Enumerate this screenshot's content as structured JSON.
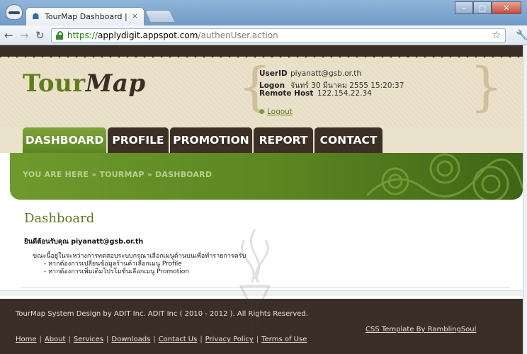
{
  "browser": {
    "tab_title": "TourMap Dashboard | [ Pov",
    "tab_close": "×",
    "url_scheme": "https://",
    "url_host": "applydigit.appspot.com",
    "url_path": "/authenUser.action",
    "window_min": "–",
    "window_max": "□",
    "window_close": "✕"
  },
  "header": {
    "logo_tour": "Tour",
    "logo_map": "Map",
    "user": {
      "userid_label": "UserID",
      "userid_value": "piyanatt@gsb.or.th",
      "logon_label": "Logon",
      "logon_value": "จันทร์ 30 มีนาคม 2555 15:20:37",
      "remote_label": "Remote Host",
      "remote_value": "122.154.22.34",
      "logout": "Logout"
    }
  },
  "nav": {
    "tabs": [
      {
        "label": "DASHBOARD",
        "active": true
      },
      {
        "label": "PROFILE",
        "active": false
      },
      {
        "label": "PROMOTION",
        "active": false
      },
      {
        "label": "REPORT",
        "active": false
      },
      {
        "label": "CONTACT",
        "active": false
      }
    ]
  },
  "breadcrumb": "YOU ARE HERE » TOURMAP » DASHBOARD",
  "content": {
    "title": "Dashboard",
    "welcome": "ยินดีต้อนรับคุณ piyanatt@gsb.or.th",
    "lines": [
      "ขณะนี้อยู่ในระหว่างการทดสอบระบบกรุณาเลือกเมนูด้านบนเพื่อทำรายการครับ",
      "- หากต้องการเปลี่ยนข้อมูลร้านค้าเลือกเมนู Profile",
      "- หากต้องการเพิ่มเติมโปรโมชั่นเลือกเมนู Promotion"
    ]
  },
  "footer": {
    "copyright": "TourMap System Design by ADIT Inc. ADIT Inc ( 2010 - 2012 ). All Rights Reserved.",
    "template_credit": "CSS Template By RamblingSoul",
    "links": [
      "Home",
      "About",
      "Services",
      "Downloads",
      "Contact Us",
      "Privacy Policy",
      "Terms of Use"
    ]
  },
  "colors": {
    "accent_green": "#5c8421",
    "header_brown": "#3b2f26",
    "header_bg": "#ebe2cc"
  }
}
